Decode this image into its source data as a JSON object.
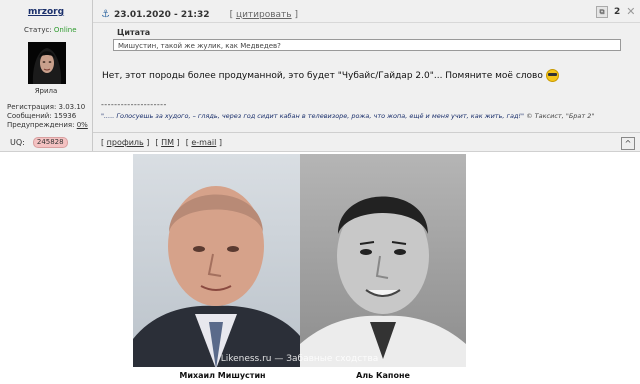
{
  "user": {
    "username": "mrzorg",
    "status_label": "Статус:",
    "status_value": "Online",
    "rank": "Ярила",
    "registration": "Регистрация: 3.03.10",
    "messages": "Сообщений: 15936",
    "warnings_label": "Предупреждения:",
    "warnings_value": "0%",
    "uq_label": "UQ:",
    "uq_value": "245828"
  },
  "post": {
    "date": "23.01.2020 - 21:32",
    "quote_link": "цитировать",
    "number": "2",
    "quote_title": "Цитата",
    "quote_text": "Мишустин, такой же жулик, как Медведев?",
    "body": "Нет, этот породы более продуманной, это будет \"Чубайс/Гайдар 2.0\"... Помяните моё слово",
    "signature_dashes": "--------------------",
    "signature_quote": "\"..... Голосуешь за худого, – глядь, через год сидит кабан в телевизоре, рожа, что жопа, ещё и меня учит, как жить, гад!\"",
    "signature_tail": "© Таксист, \"Брат 2\"",
    "links": {
      "profile": "профиль",
      "pm": "ПМ",
      "email": "e-mail"
    }
  },
  "image": {
    "watermark": "Likeness.ru — Забавные сходства",
    "caption_left": "Михаил Мишустин",
    "caption_right": "Аль Капоне"
  }
}
